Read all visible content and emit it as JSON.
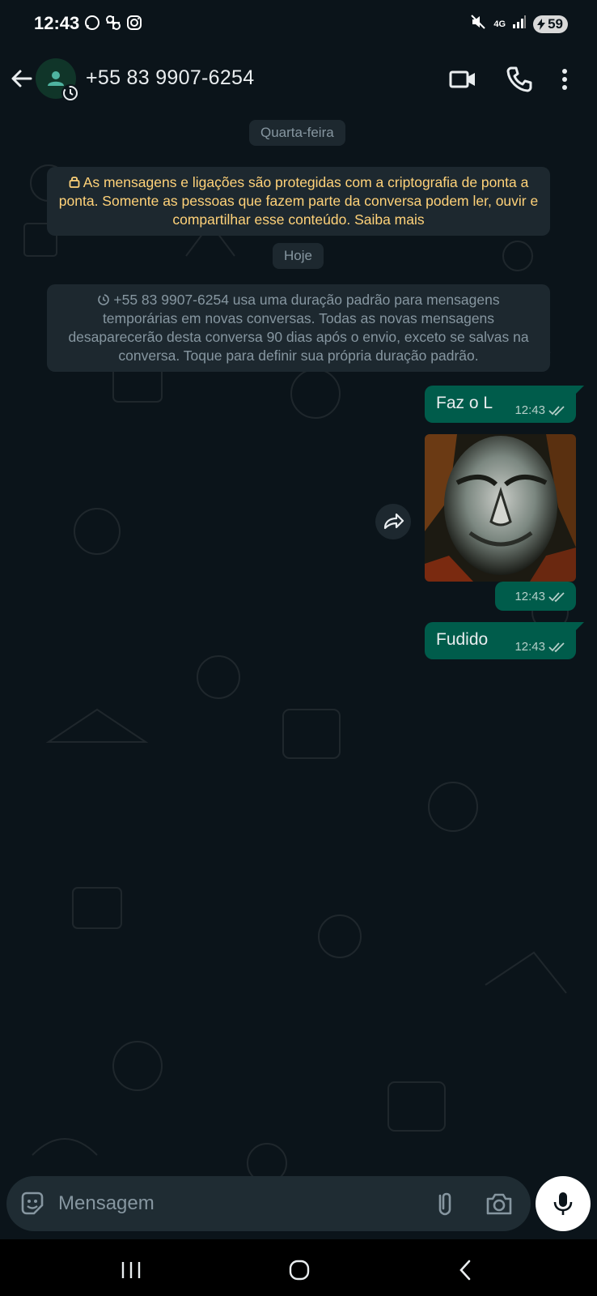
{
  "status_bar": {
    "time": "12:43",
    "network": "4G",
    "battery": "59",
    "app_icons": [
      "whatsapp-icon",
      "pinwheel-icon",
      "instagram-icon"
    ],
    "indicators": [
      "mute-icon",
      "signal-icon"
    ]
  },
  "header": {
    "contact_name": "+55 83 9907-6254",
    "icons": [
      "back-arrow-icon",
      "avatar-icon",
      "timer-icon",
      "video-call-icon",
      "phone-icon",
      "more-vert-icon"
    ]
  },
  "chat": {
    "date_divider_1": "Quarta-feira",
    "encryption_notice": "As mensagens e ligações são protegidas com a criptografia de ponta a ponta. Somente as pessoas que fazem parte da conversa podem ler, ouvir e compartilhar esse conteúdo. Saiba mais",
    "date_divider_2": "Hoje",
    "temporary_notice": "+55 83 9907-6254 usa uma duração padrão para mensagens temporárias em novas conversas. Todas as novas mensagens desaparecerão desta conversa 90 dias após o envio, exceto se salvas na conversa. Toque para definir sua própria duração padrão.",
    "messages": [
      {
        "type": "text",
        "text": "Faz o L",
        "time": "12:43",
        "status": "read"
      },
      {
        "type": "image",
        "text": "",
        "time": "12:43",
        "status": "read"
      },
      {
        "type": "text",
        "text": "Fudido",
        "time": "12:43",
        "status": "read"
      }
    ]
  },
  "input": {
    "placeholder": "Mensagem",
    "value": ""
  },
  "colors": {
    "background": "#0b141a",
    "outgoing_bubble": "#005c4b",
    "system_box": "#1d282f",
    "encryption_text": "#ffd279",
    "muted_text": "#8696a0",
    "input_pill": "#1f2c33"
  }
}
